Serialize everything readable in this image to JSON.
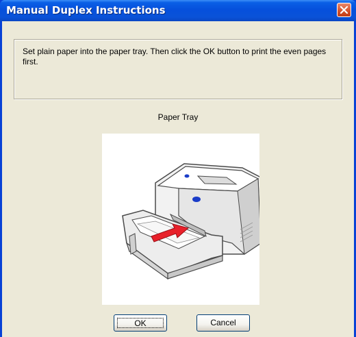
{
  "window": {
    "title": "Manual Duplex Instructions"
  },
  "instructions": {
    "text": "Set plain paper into the paper tray. Then click the OK button to print the even pages first."
  },
  "illustration": {
    "caption": "Paper Tray"
  },
  "buttons": {
    "ok_label": "OK",
    "cancel_label": "Cancel"
  },
  "colors": {
    "titlebar": "#0a52d8",
    "dialog_background": "#ece9d8",
    "close_button": "#d8542d",
    "arrow": "#e8202a",
    "printer_accent": "#1a3cc8"
  }
}
